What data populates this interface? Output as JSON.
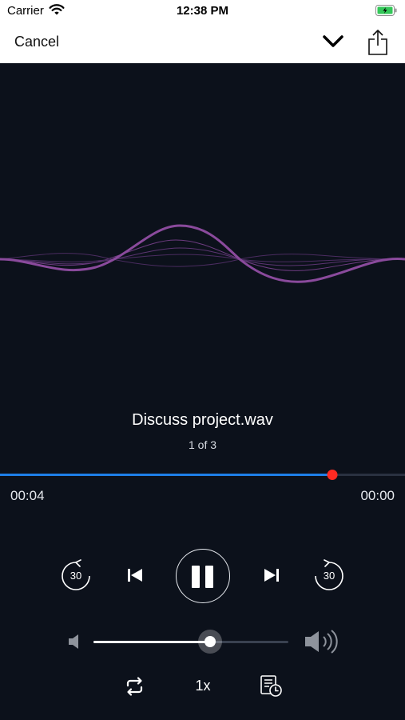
{
  "status_bar": {
    "carrier": "Carrier",
    "time": "12:38 PM"
  },
  "nav": {
    "cancel_label": "Cancel",
    "collapse_icon": "chevron-down-icon",
    "share_icon": "share-icon"
  },
  "track": {
    "title": "Discuss project.wav",
    "position_label": "1 of 3"
  },
  "progress": {
    "elapsed": "00:04",
    "remaining": "00:00",
    "fraction": 0.82
  },
  "controls": {
    "skip_back_label": "30",
    "skip_forward_label": "30",
    "speed_label": "1x"
  },
  "volume": {
    "level": 0.6
  },
  "colors": {
    "background": "#0c111b",
    "progress": "#1e7fe8",
    "scrubber": "#ff2a22",
    "waveform": "#8a4a9c"
  }
}
